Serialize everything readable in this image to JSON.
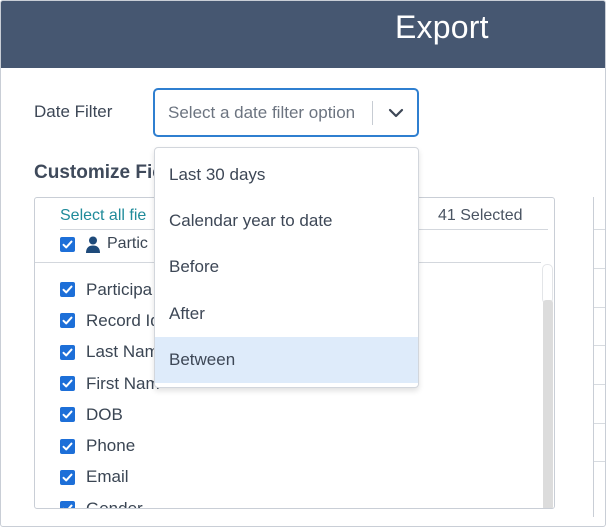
{
  "header": {
    "title": "Export",
    "background": "#465771"
  },
  "date_filter": {
    "label": "Date Filter",
    "placeholder": "Select a date filter option",
    "options": [
      "Last 30 days",
      "Calendar year to date",
      "Before",
      "After",
      "Between"
    ],
    "highlighted_option": "Between",
    "accent": "#2f7fd0"
  },
  "customize_fields": {
    "title": "Customize Fie",
    "select_all_label": "Select all fie",
    "selected_count": "41 Selected",
    "group": {
      "checked": true,
      "icon": "person-icon",
      "label": "Partic"
    },
    "fields": [
      {
        "label": "Participa",
        "checked": true
      },
      {
        "label": "Record Id",
        "checked": true
      },
      {
        "label": "Last Nam",
        "checked": true
      },
      {
        "label": "First Nam",
        "checked": true
      },
      {
        "label": "DOB",
        "checked": true
      },
      {
        "label": "Phone",
        "checked": true
      },
      {
        "label": "Email",
        "checked": true
      },
      {
        "label": "Gender",
        "checked": true
      }
    ],
    "checkbox_color": "#1d6fd8"
  }
}
